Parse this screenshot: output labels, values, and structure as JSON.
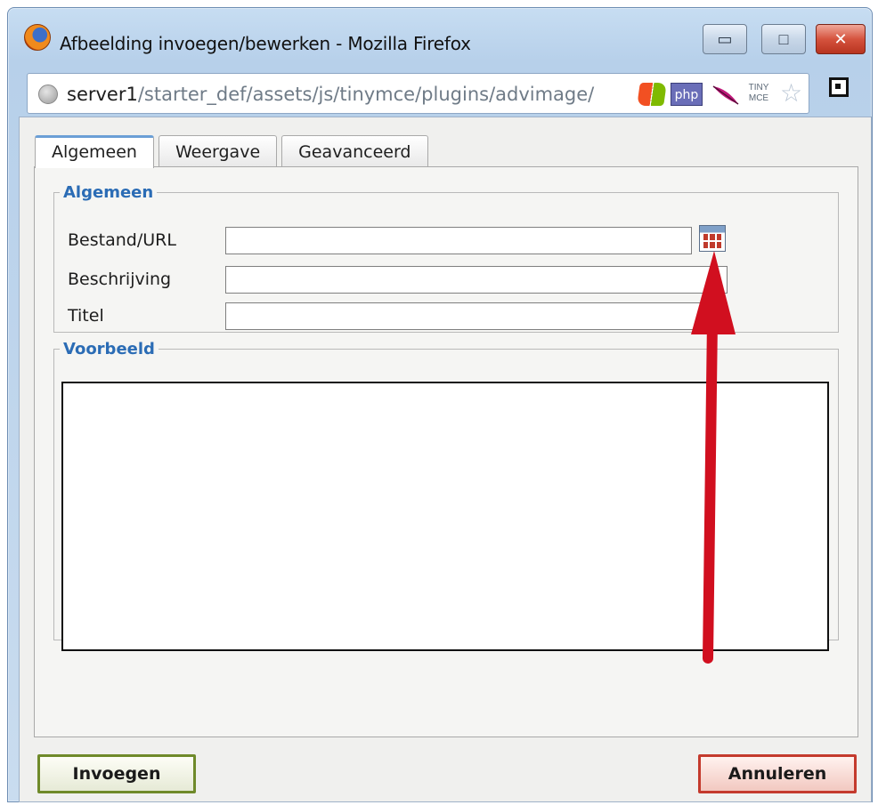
{
  "window": {
    "title": "Afbeelding invoegen/bewerken - Mozilla Firefox",
    "buttons": {
      "minimize": "▭",
      "maximize": "□",
      "close": "✕"
    }
  },
  "address_bar": {
    "host": "server1",
    "path": "/starter_def/assets/js/tinymce/plugins/advimage/",
    "addons": {
      "php_label": "php",
      "tiny_label": "TINY MCE",
      "star": "☆"
    }
  },
  "dialog": {
    "tabs": [
      "Algemeen",
      "Weergave",
      "Geavanceerd"
    ],
    "active_tab": "Algemeen",
    "general_group": {
      "legend": "Algemeen",
      "fields": [
        {
          "label": "Bestand/URL",
          "value": ""
        },
        {
          "label": "Beschrijving",
          "value": ""
        },
        {
          "label": "Titel",
          "value": ""
        }
      ]
    },
    "preview_group": {
      "legend": "Voorbeeld"
    },
    "buttons": {
      "insert": "Invoegen",
      "cancel": "Annuleren"
    }
  },
  "colors": {
    "legend": "#2b6cb5",
    "annotation_arrow": "#d10f1f",
    "insert_border": "#6f8a2a",
    "cancel_border": "#c43a2d"
  },
  "icons": [
    "firefox-icon",
    "globe-icon",
    "windows-icon",
    "php-icon",
    "feather-icon",
    "tinymce-icon",
    "bookmark-star-icon",
    "qr-code-icon",
    "browse-icon"
  ]
}
